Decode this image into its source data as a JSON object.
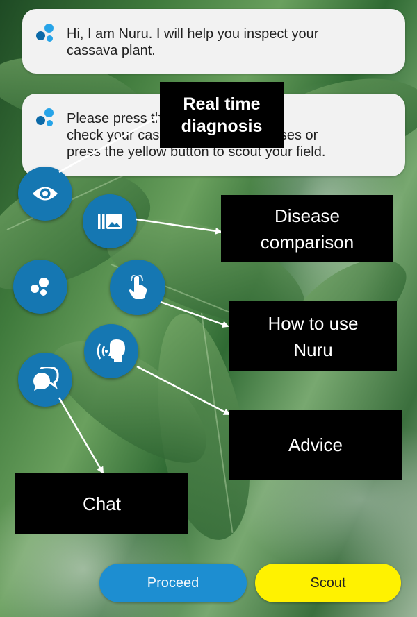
{
  "chat": {
    "greeting": "Hi, I am Nuru. I will help you inspect your\ncassava plant.",
    "instruction": "Please press the red button to\ncheck your cassava plant for diseases or\npress the yellow button to scout your field."
  },
  "callouts": {
    "realtime": "Real time\ndiagnosis",
    "comparison": "Disease\ncomparison",
    "howto": "How to use\nNuru",
    "advice": "Advice",
    "chat": "Chat"
  },
  "buttons": {
    "proceed": "Proceed",
    "scout": "Scout"
  },
  "icons": {
    "realtime_fab": "eye-icon",
    "comparison_fab": "gallery-icon",
    "nuru_fab": "nuru-dots-icon",
    "howto_fab": "tap-hand-icon",
    "advice_fab": "speaking-head-icon",
    "chat_fab": "chat-bubbles-icon"
  },
  "colors": {
    "fab": "#1577b2",
    "proceed": "#1d8ed1",
    "scout": "#fff200",
    "callout_bg": "#000000"
  }
}
